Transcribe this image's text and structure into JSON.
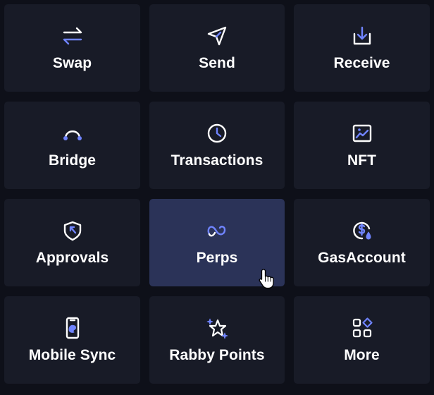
{
  "colors": {
    "background": "#0e1019",
    "tile": "#181b27",
    "tile_active": "#2b3358",
    "icon_white": "#ffffff",
    "icon_accent": "#7084ff",
    "label": "#ffffff"
  },
  "tiles": [
    {
      "label": "Swap",
      "icon": "swap-arrows-icon"
    },
    {
      "label": "Send",
      "icon": "send-paper-plane-icon"
    },
    {
      "label": "Receive",
      "icon": "receive-download-icon"
    },
    {
      "label": "Bridge",
      "icon": "bridge-arc-icon"
    },
    {
      "label": "Transactions",
      "icon": "clock-icon"
    },
    {
      "label": "NFT",
      "icon": "image-icon"
    },
    {
      "label": "Approvals",
      "icon": "shield-icon"
    },
    {
      "label": "Perps",
      "icon": "infinity-wave-icon",
      "active": true
    },
    {
      "label": "GasAccount",
      "icon": "gas-coin-icon"
    },
    {
      "label": "Mobile Sync",
      "icon": "mobile-phone-icon"
    },
    {
      "label": "Rabby Points",
      "icon": "star-sparkle-icon"
    },
    {
      "label": "More",
      "icon": "more-grid-icon"
    }
  ]
}
